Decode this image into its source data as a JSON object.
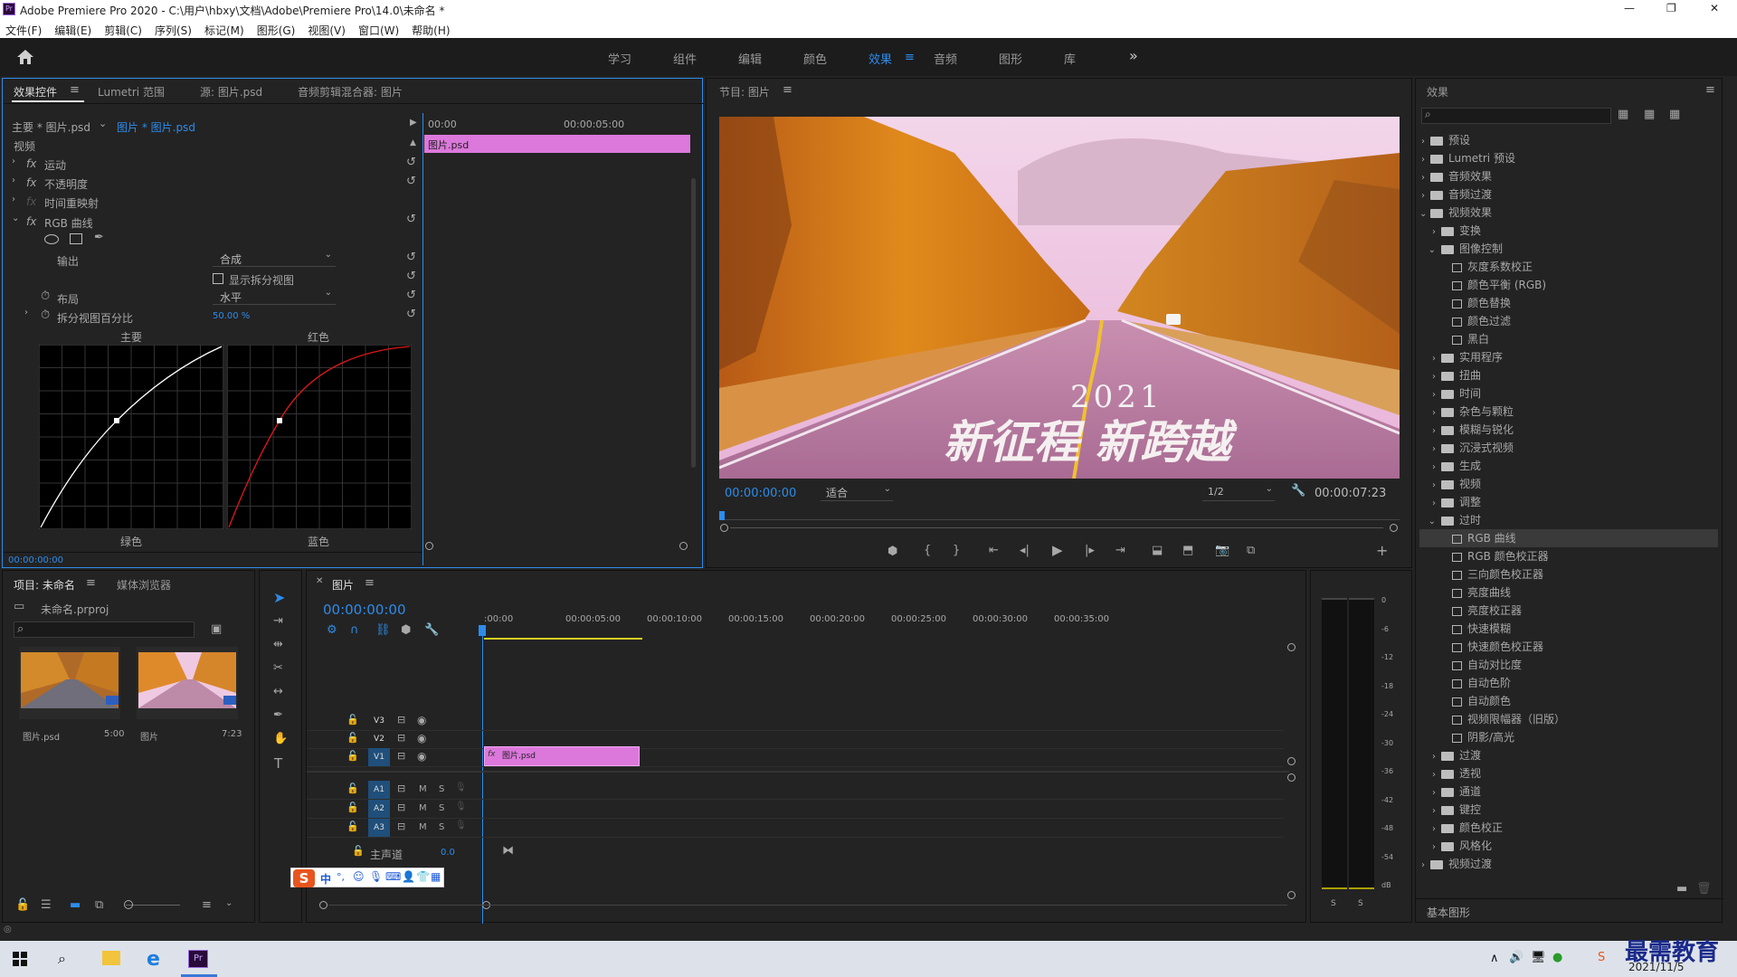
{
  "window": {
    "title": "Adobe Premiere Pro 2020 - C:\\用户\\hbxy\\文档\\Adobe\\Premiere Pro\\14.0\\未命名 *",
    "min": "—",
    "max": "❐",
    "close": "✕"
  },
  "menu": [
    "文件(F)",
    "编辑(E)",
    "剪辑(C)",
    "序列(S)",
    "标记(M)",
    "图形(G)",
    "视图(V)",
    "窗口(W)",
    "帮助(H)"
  ],
  "workspaces": [
    "学习",
    "组件",
    "编辑",
    "颜色",
    "效果",
    "音频",
    "图形",
    "库"
  ],
  "workspaces_more": "»",
  "effect_controls": {
    "tabs": [
      "效果控件",
      "Lumetri 范围",
      "源: 图片.psd",
      "音频剪辑混合器: 图片"
    ],
    "master": "主要 * 图片.psd",
    "clip": "图片 * 图片.psd",
    "ruler": [
      "00:00",
      "00:00:05:00"
    ],
    "clip_label": "图片.psd",
    "section": "视频",
    "rows": [
      "运动",
      "不透明度",
      "时间重映射",
      "RGB 曲线"
    ],
    "output_label": "输出",
    "output_value": "合成",
    "split_view_label": "显示拆分视图",
    "layout_label": "布局",
    "layout_value": "水平",
    "split_pct_label": "拆分视图百分比",
    "split_pct_value": "50.00 %",
    "curve_labels": [
      "主要",
      "红色",
      "绿色",
      "蓝色"
    ],
    "timecode": "00:00:00:00"
  },
  "program": {
    "title": "节目: 图片",
    "timecode": "00:00:00:00",
    "fit": "适合",
    "res": "1/2",
    "duration": "00:00:07:23",
    "image_text_1": "2021",
    "image_text_2": "新征程 新跨越"
  },
  "effects": {
    "title": "效果",
    "tree": [
      {
        "label": "预设",
        "indent": 0,
        "type": "folder",
        "open": false
      },
      {
        "label": "Lumetri 预设",
        "indent": 0,
        "type": "folder",
        "open": false
      },
      {
        "label": "音频效果",
        "indent": 0,
        "type": "folder",
        "open": false
      },
      {
        "label": "音频过渡",
        "indent": 0,
        "type": "folder",
        "open": false
      },
      {
        "label": "视频效果",
        "indent": 0,
        "type": "folder",
        "open": true
      },
      {
        "label": "变换",
        "indent": 1,
        "type": "folder",
        "open": false
      },
      {
        "label": "图像控制",
        "indent": 1,
        "type": "folder",
        "open": true
      },
      {
        "label": "灰度系数校正",
        "indent": 2,
        "type": "fx"
      },
      {
        "label": "颜色平衡 (RGB)",
        "indent": 2,
        "type": "fx"
      },
      {
        "label": "颜色替换",
        "indent": 2,
        "type": "fx"
      },
      {
        "label": "颜色过滤",
        "indent": 2,
        "type": "fx"
      },
      {
        "label": "黑白",
        "indent": 2,
        "type": "fx"
      },
      {
        "label": "实用程序",
        "indent": 1,
        "type": "folder",
        "open": false
      },
      {
        "label": "扭曲",
        "indent": 1,
        "type": "folder",
        "open": false
      },
      {
        "label": "时间",
        "indent": 1,
        "type": "folder",
        "open": false
      },
      {
        "label": "杂色与颗粒",
        "indent": 1,
        "type": "folder",
        "open": false
      },
      {
        "label": "模糊与锐化",
        "indent": 1,
        "type": "folder",
        "open": false
      },
      {
        "label": "沉浸式视频",
        "indent": 1,
        "type": "folder",
        "open": false
      },
      {
        "label": "生成",
        "indent": 1,
        "type": "folder",
        "open": false
      },
      {
        "label": "视频",
        "indent": 1,
        "type": "folder",
        "open": false
      },
      {
        "label": "调整",
        "indent": 1,
        "type": "folder",
        "open": false
      },
      {
        "label": "过时",
        "indent": 1,
        "type": "folder",
        "open": true
      },
      {
        "label": "RGB 曲线",
        "indent": 2,
        "type": "fx",
        "selected": true
      },
      {
        "label": "RGB 颜色校正器",
        "indent": 2,
        "type": "fx"
      },
      {
        "label": "三向颜色校正器",
        "indent": 2,
        "type": "fx"
      },
      {
        "label": "亮度曲线",
        "indent": 2,
        "type": "fx"
      },
      {
        "label": "亮度校正器",
        "indent": 2,
        "type": "fx"
      },
      {
        "label": "快速模糊",
        "indent": 2,
        "type": "fx"
      },
      {
        "label": "快速颜色校正器",
        "indent": 2,
        "type": "fx"
      },
      {
        "label": "自动对比度",
        "indent": 2,
        "type": "fx"
      },
      {
        "label": "自动色阶",
        "indent": 2,
        "type": "fx"
      },
      {
        "label": "自动颜色",
        "indent": 2,
        "type": "fx"
      },
      {
        "label": "视频限幅器（旧版）",
        "indent": 2,
        "type": "fx"
      },
      {
        "label": "阴影/高光",
        "indent": 2,
        "type": "fx"
      },
      {
        "label": "过渡",
        "indent": 1,
        "type": "folder",
        "open": false
      },
      {
        "label": "透视",
        "indent": 1,
        "type": "folder",
        "open": false
      },
      {
        "label": "通道",
        "indent": 1,
        "type": "folder",
        "open": false
      },
      {
        "label": "键控",
        "indent": 1,
        "type": "folder",
        "open": false
      },
      {
        "label": "颜色校正",
        "indent": 1,
        "type": "folder",
        "open": false
      },
      {
        "label": "风格化",
        "indent": 1,
        "type": "folder",
        "open": false
      },
      {
        "label": "视频过渡",
        "indent": 0,
        "type": "folder",
        "open": false
      }
    ],
    "footer": "基本图形"
  },
  "project": {
    "tabs": [
      "项目: 未命名",
      "媒体浏览器"
    ],
    "file": "未命名.prproj",
    "items": [
      {
        "name": "图片.psd",
        "dur": "5:00"
      },
      {
        "name": "图片",
        "dur": "7:23"
      }
    ]
  },
  "timeline": {
    "tab": "图片",
    "timecode": "00:00:00:00",
    "ruler": [
      ":00:00",
      "00:00:05:00",
      "00:00:10:00",
      "00:00:15:00",
      "00:00:20:00",
      "00:00:25:00",
      "00:00:30:00",
      "00:00:35:00"
    ],
    "video_tracks": [
      "V3",
      "V2",
      "V1"
    ],
    "audio_tracks": [
      "A1",
      "A2",
      "A3"
    ],
    "master": "主声道",
    "master_val": "0.0",
    "clip": "图片.psd",
    "m": "M",
    "s": "S"
  },
  "meter": {
    "scale": [
      "0",
      "-6",
      "-12",
      "-18",
      "-24",
      "-30",
      "-36",
      "-42",
      "-48",
      "-54",
      "dB"
    ],
    "s_left": "S",
    "s_right": "S"
  },
  "ime": [
    "中",
    "°,"
  ],
  "taskbar": {
    "date": "2021/11/5",
    "watermark": "最需教育"
  }
}
